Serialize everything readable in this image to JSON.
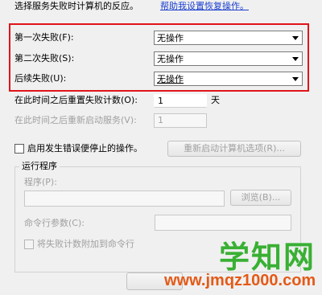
{
  "header": {
    "instruction": "选择服务失败时计算机的反应。",
    "help_link": "帮助我设置恢复操作。"
  },
  "failures": [
    {
      "label": "第一次失败(F):",
      "value": "无操作"
    },
    {
      "label": "第二次失败(S):",
      "value": "无操作"
    },
    {
      "label": "后续失败(U):",
      "value": "无操作"
    }
  ],
  "reset_count": {
    "label": "在此时间之后重置失败计数(O):",
    "value": "1",
    "unit": "天"
  },
  "restart_service": {
    "label": "在此时间之后重新启动服务(V):",
    "value": "1"
  },
  "enable_actions": {
    "label": "启用发生错误便停止的操作。",
    "button": "重新启动计算机选项(R)..."
  },
  "run_program": {
    "legend": "运行程序",
    "program_label": "程序(P):",
    "browse_button": "浏览(B)...",
    "args_label": "命令行参数(C):",
    "append_label": "将失败计数附加到命令行"
  },
  "watermark": {
    "text": "学知网",
    "url": "www.jmqz1000.com"
  },
  "colors": {
    "highlight": "#e0141a",
    "link": "#1a3fcf",
    "watermark_green": "#39b033",
    "watermark_orange": "#e45a17"
  }
}
